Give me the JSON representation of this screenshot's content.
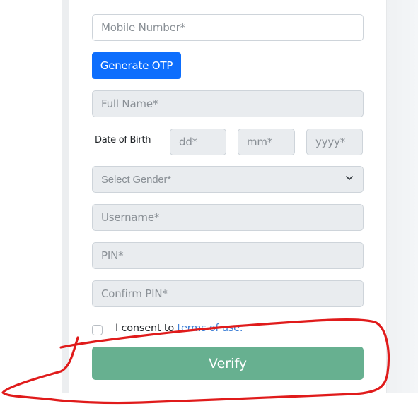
{
  "form": {
    "mobile_placeholder": "Mobile Number*",
    "generate_otp_label": "Generate OTP",
    "full_name_placeholder": "Full Name*",
    "dob_label": "Date of Birth",
    "dob_day_placeholder": "dd*",
    "dob_month_placeholder": "mm*",
    "dob_year_placeholder": "yyyy*",
    "gender_selected": "Select Gender*",
    "username_placeholder": "Username*",
    "pin_placeholder": "PIN*",
    "confirm_pin_placeholder": "Confirm PIN*",
    "consent_prefix": "I consent to ",
    "consent_link": "terms of use.",
    "consent_checked": false,
    "verify_label": "Verify"
  },
  "colors": {
    "primary": "#0d6efd",
    "verify": "#67b090",
    "disabled_field": "#e9ecef",
    "link": "#3d7fd6",
    "annotation": "#e01b1b"
  },
  "annotation": {
    "type": "freehand-red-circle",
    "target": "consent-row-and-verify-button"
  }
}
